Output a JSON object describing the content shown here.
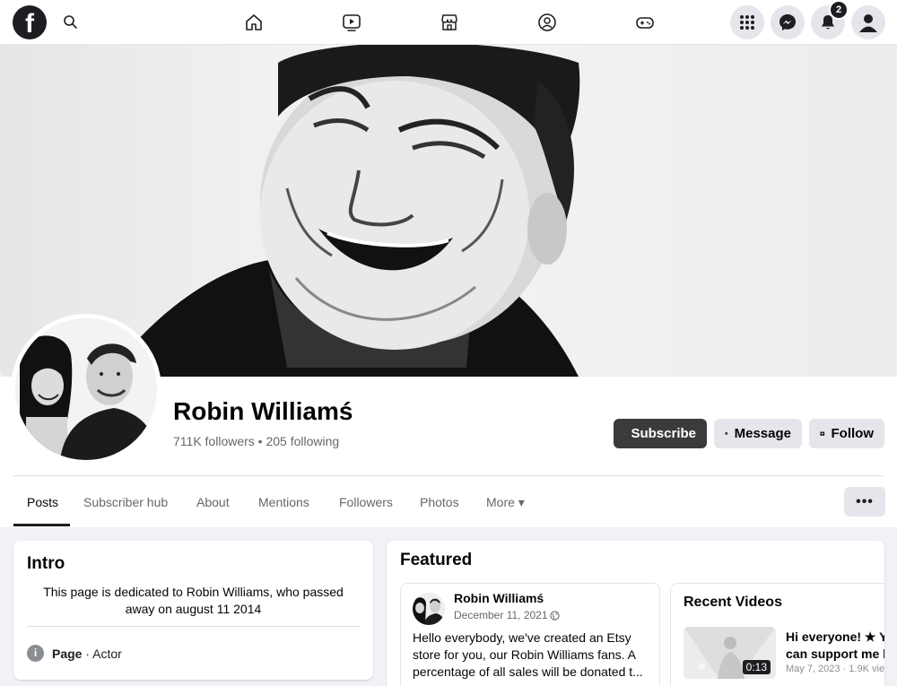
{
  "topbar": {
    "logo_letter": "f",
    "nav_icons": [
      "home-icon",
      "video-icon",
      "marketplace-icon",
      "groups-icon",
      "gaming-icon"
    ],
    "notifications_count": "2"
  },
  "profile": {
    "name": "Robin Williamś",
    "stats": "711K followers • 205 following"
  },
  "actions": {
    "subscribe": "Subscribe",
    "message": "Message",
    "follow": "Follow"
  },
  "tabs": [
    {
      "label": "Posts"
    },
    {
      "label": "Subscriber hub"
    },
    {
      "label": "About"
    },
    {
      "label": "Mentions"
    },
    {
      "label": "Followers"
    },
    {
      "label": "Photos"
    },
    {
      "label": "More ▾"
    }
  ],
  "more_menu": "•••",
  "intro": {
    "title": "Intro",
    "text": "This page is dedicated to Robin Williams, who passed away on august 11 2014",
    "info_label": "Page",
    "info_value": " · Actor"
  },
  "featured": {
    "title": "Featured",
    "post": {
      "author": "Robin Williamś",
      "date": "December 11, 2021",
      "line1": "Hello everybody, we've created an Etsy",
      "line2": "store for you, our Robin Williams fans. A",
      "line3": "percentage of all sales will be donated t..."
    },
    "videos": {
      "title": "Recent Videos",
      "duration": "0:13",
      "line1": "Hi everyone!  ★  Y",
      "line2": "can support me b",
      "meta": "May 7, 2023 · 1.9K vie"
    }
  }
}
